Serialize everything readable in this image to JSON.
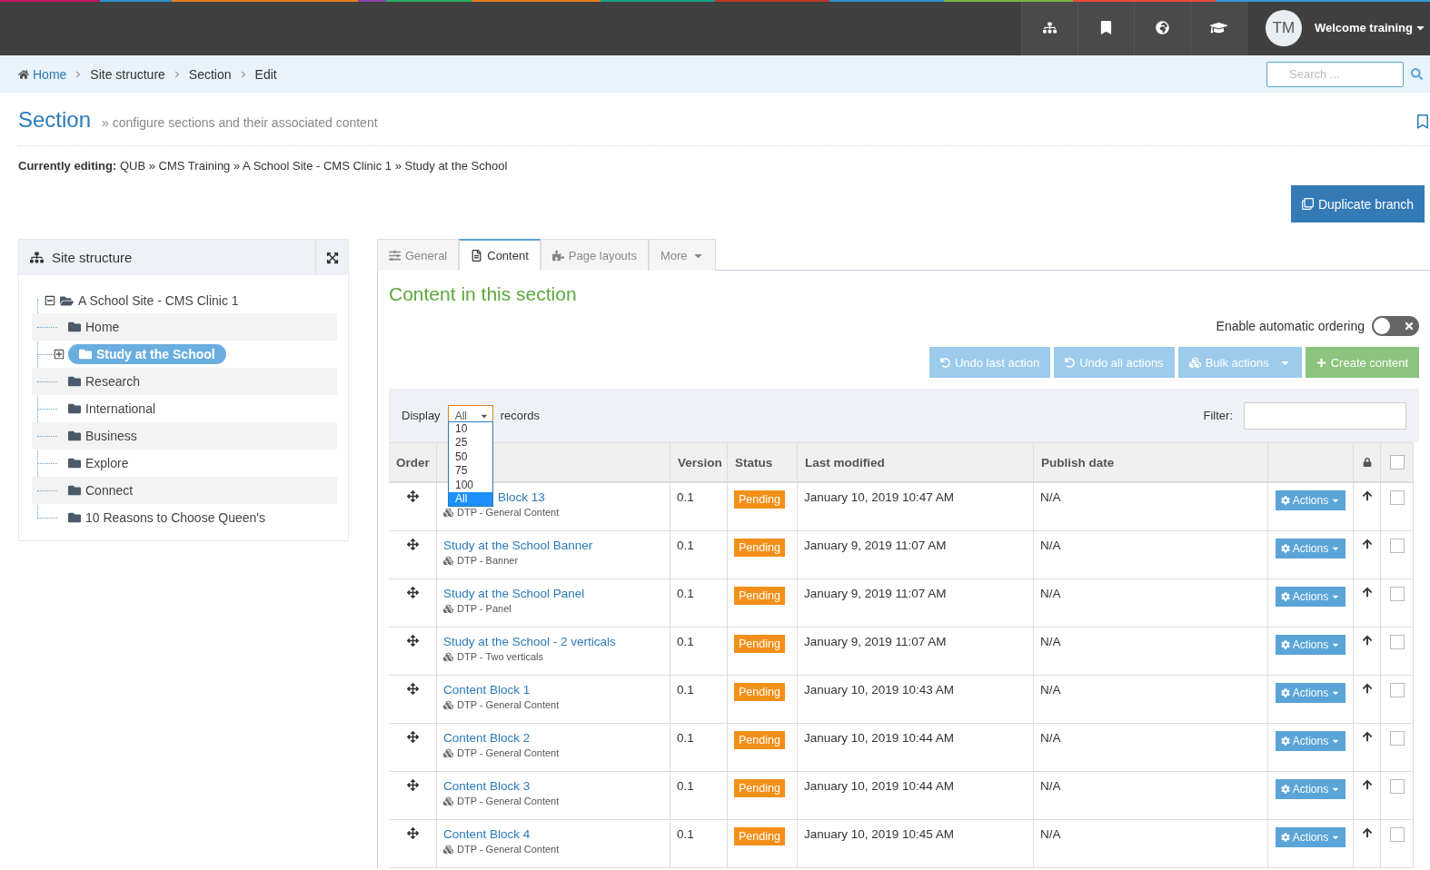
{
  "topbar": {
    "avatar": "TM",
    "welcome": "Welcome training"
  },
  "breadcrumb": [
    {
      "label": "Home",
      "link": true
    },
    {
      "label": "Site structure",
      "link": false
    },
    {
      "label": "Section",
      "link": false
    },
    {
      "label": "Edit",
      "link": false
    }
  ],
  "search": {
    "placeholder": "Search ..."
  },
  "page": {
    "title": "Section",
    "subtitle": "» configure sections and their associated content"
  },
  "editing": {
    "label": "Currently editing:",
    "path": "QUB » CMS Training » A School Site - CMS Clinic 1 » Study at the School"
  },
  "duplicate_button": "Duplicate branch",
  "site_structure": {
    "title": "Site structure",
    "root": {
      "label": "A School Site - CMS Clinic 1",
      "expanded": true,
      "children": [
        {
          "label": "Home",
          "selected": false,
          "has_children": false
        },
        {
          "label": "Study at the School",
          "selected": true,
          "has_children": true
        },
        {
          "label": "Research",
          "selected": false,
          "has_children": false
        },
        {
          "label": "International",
          "selected": false,
          "has_children": false
        },
        {
          "label": "Business",
          "selected": false,
          "has_children": false
        },
        {
          "label": "Explore",
          "selected": false,
          "has_children": false
        },
        {
          "label": "Connect",
          "selected": false,
          "has_children": false
        },
        {
          "label": "10 Reasons to Choose Queen's",
          "selected": false,
          "has_children": false
        }
      ]
    }
  },
  "tabs": [
    {
      "label": "General",
      "selected": false
    },
    {
      "label": "Content",
      "selected": true
    },
    {
      "label": "Page layouts",
      "selected": false
    },
    {
      "label": "More",
      "selected": false
    }
  ],
  "content": {
    "title": "Content in this section",
    "ordering_label": "Enable automatic ordering",
    "ordering_on": false,
    "buttons": [
      {
        "label": "Undo last action",
        "kind": "undo"
      },
      {
        "label": "Undo all actions",
        "kind": "undo"
      },
      {
        "label": "Bulk actions",
        "kind": "bulk"
      },
      {
        "label": "Create content",
        "kind": "create"
      }
    ],
    "display_label": "Display",
    "display_value": "All",
    "records_label": "records",
    "filter_label": "Filter:",
    "display_options": [
      {
        "label": "10",
        "selected": false
      },
      {
        "label": "25",
        "selected": false
      },
      {
        "label": "50",
        "selected": false
      },
      {
        "label": "75",
        "selected": false
      },
      {
        "label": "100",
        "selected": false
      },
      {
        "label": "All",
        "selected": true
      }
    ],
    "columns": [
      "Order",
      "",
      "Version",
      "Status",
      "Last modified",
      "Publish date"
    ],
    "select_all_checked": false,
    "rows": [
      {
        "name": "Block 13",
        "covered": true,
        "type": "DTP - General Content",
        "version": "0.1",
        "status": "Pending",
        "modified": "January 10, 2019 10:47 AM",
        "publish": "N/A",
        "action": "Actions",
        "checked": false
      },
      {
        "name": "Study at the School Banner",
        "covered": false,
        "type": "DTP - Banner",
        "version": "0.1",
        "status": "Pending",
        "modified": "January 9, 2019 11:07 AM",
        "publish": "N/A",
        "action": "Actions",
        "checked": false
      },
      {
        "name": "Study at the School Panel",
        "covered": false,
        "type": "DTP - Panel",
        "version": "0.1",
        "status": "Pending",
        "modified": "January 9, 2019 11:07 AM",
        "publish": "N/A",
        "action": "Actions",
        "checked": false
      },
      {
        "name": "Study at the School - 2 verticals",
        "covered": false,
        "type": "DTP - Two verticals",
        "version": "0.1",
        "status": "Pending",
        "modified": "January 9, 2019 11:07 AM",
        "publish": "N/A",
        "action": "Actions",
        "checked": false
      },
      {
        "name": "Content Block 1",
        "covered": false,
        "type": "DTP - General Content",
        "version": "0.1",
        "status": "Pending",
        "modified": "January 10, 2019 10:43 AM",
        "publish": "N/A",
        "action": "Actions",
        "checked": false
      },
      {
        "name": "Content Block 2",
        "covered": false,
        "type": "DTP - General Content",
        "version": "0.1",
        "status": "Pending",
        "modified": "January 10, 2019 10:44 AM",
        "publish": "N/A",
        "action": "Actions",
        "checked": false
      },
      {
        "name": "Content Block 3",
        "covered": false,
        "type": "DTP - General Content",
        "version": "0.1",
        "status": "Pending",
        "modified": "January 10, 2019 10:44 AM",
        "publish": "N/A",
        "action": "Actions",
        "checked": false
      },
      {
        "name": "Content Block 4",
        "covered": false,
        "type": "DTP - General Content",
        "version": "0.1",
        "status": "Pending",
        "modified": "January 10, 2019 10:45 AM",
        "publish": "N/A",
        "action": "Actions",
        "checked": false
      }
    ]
  }
}
